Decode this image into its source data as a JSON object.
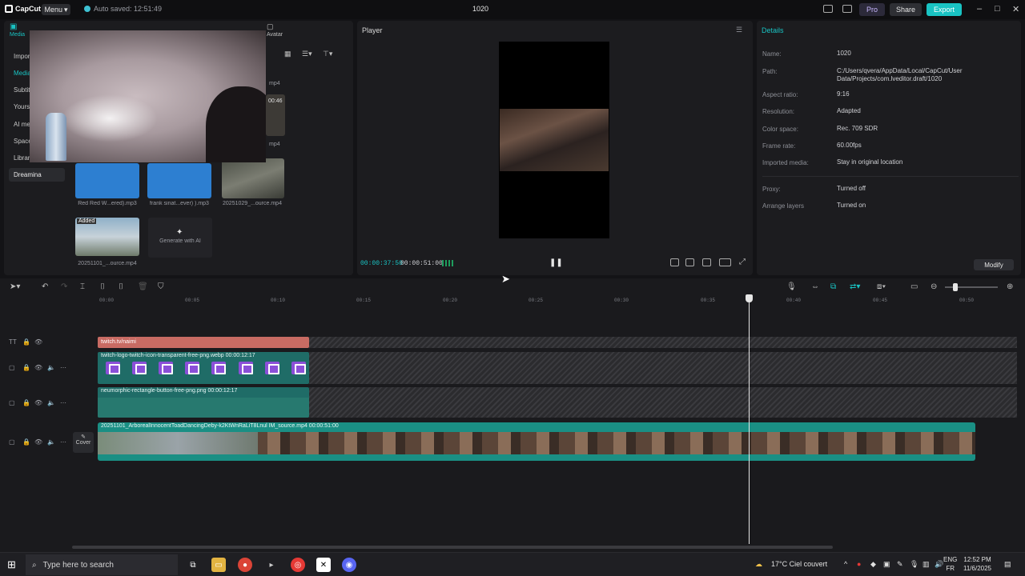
{
  "titlebar": {
    "logo_text": "CapCut",
    "menu_label": "Menu",
    "autosave_text": "Auto saved: 12:51:49",
    "project_name": "1020",
    "pro_label": "Pro",
    "share_label": "Share",
    "export_label": "Export"
  },
  "media": {
    "top_tabs": [
      "Media",
      "Avatar"
    ],
    "side_tabs": [
      "Import",
      "Media",
      "Subtitles",
      "Yours",
      "AI media",
      "Spaces",
      "Library",
      "Dreamina"
    ],
    "items": [
      {
        "caption": "Red Red W...ered).mp3"
      },
      {
        "caption": "frank sinat...ever) ).mp3"
      },
      {
        "caption": "20251029_...ource.mp4"
      },
      {
        "caption": "20251101_...ource.mp4",
        "badge": "Added"
      }
    ],
    "partial_captions": [
      "mp4",
      "00:46",
      "mp4",
      "mp4"
    ],
    "generate_ai_label": "Generate with AI"
  },
  "player": {
    "title": "Player",
    "current_time": "00:00:37:50",
    "total_time": "00:00:51:00"
  },
  "details": {
    "title": "Details",
    "rows": [
      {
        "label": "Name:",
        "value": "1020"
      },
      {
        "label": "Path:",
        "value": "C:/Users/qvera/AppData/Local/CapCut/User Data/Projects/com.lveditor.draft/1020"
      },
      {
        "label": "Aspect ratio:",
        "value": "9:16"
      },
      {
        "label": "Resolution:",
        "value": "Adapted"
      },
      {
        "label": "Color space:",
        "value": "Rec. 709 SDR"
      },
      {
        "label": "Frame rate:",
        "value": "60.00fps"
      },
      {
        "label": "Imported media:",
        "value": "Stay in original location"
      },
      {
        "label": "Proxy:",
        "value": "Turned off"
      },
      {
        "label": "Arrange layers",
        "value": "Turned on"
      }
    ],
    "modify_label": "Modify"
  },
  "timeline": {
    "ruler": [
      "00:00",
      "00:05",
      "00:10",
      "00:15",
      "00:20",
      "00:25",
      "00:30",
      "00:35",
      "00:40",
      "00:45",
      "00:50"
    ],
    "text_clip": "twitch.tv/naimi",
    "sticker_clip_1": "twitch-logo-twitch-icon-transparent-free-png.webp   00:00:12:17",
    "sticker_clip_2": "neumorphic-rectangle-button-free-png.png   00:00:12:17",
    "main_clip": "20251101_ArborealInnocentToadDancingDeby-k2KtWnRaLiT8Lnul IM_source.mp4   00:00:51:00",
    "cover_label": "Cover"
  },
  "taskbar": {
    "search_placeholder": "Type here to search",
    "weather": "17°C  Ciel couvert",
    "lang_1": "ENG",
    "lang_2": "FR",
    "time": "12:52 PM",
    "date": "11/6/2025"
  }
}
